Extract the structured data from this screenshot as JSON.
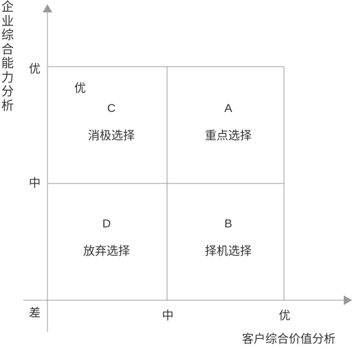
{
  "axes": {
    "y_title": "企业综合能力分析",
    "x_title": "客户综合价值分析",
    "y_ticks": {
      "high": "优",
      "mid": "中"
    },
    "x_ticks": {
      "origin": "差",
      "mid": "中",
      "high": "优"
    }
  },
  "extra_label": "优",
  "quadrants": {
    "top_left": {
      "letter": "C",
      "name": "消极选择"
    },
    "top_right": {
      "letter": "A",
      "name": "重点选择"
    },
    "bottom_left": {
      "letter": "D",
      "name": "放弃选择"
    },
    "bottom_right": {
      "letter": "B",
      "name": "择机选择"
    }
  },
  "colors": {
    "line": "#999999",
    "arrow": "#999999",
    "text": "#333333"
  }
}
